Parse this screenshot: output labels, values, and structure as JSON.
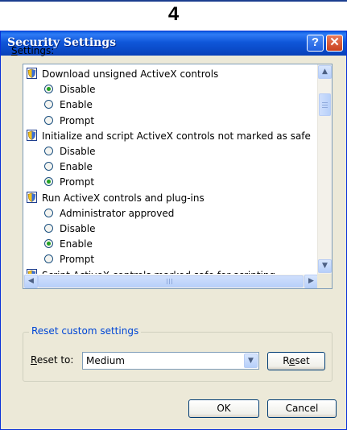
{
  "step": {
    "number": "4"
  },
  "dialog": {
    "title": "Security Settings",
    "help_glyph": "?",
    "close_glyph": "✕",
    "settings_label_first": "S",
    "settings_label_rest": "ettings:",
    "groups": [
      {
        "label": "Download unsigned ActiveX controls",
        "options": [
          {
            "label": "Disable",
            "selected": true
          },
          {
            "label": "Enable",
            "selected": false
          },
          {
            "label": "Prompt",
            "selected": false
          }
        ]
      },
      {
        "label": "Initialize and script ActiveX controls not marked as safe",
        "options": [
          {
            "label": "Disable",
            "selected": false
          },
          {
            "label": "Enable",
            "selected": false
          },
          {
            "label": "Prompt",
            "selected": true
          }
        ]
      },
      {
        "label": "Run ActiveX controls and plug-ins",
        "options": [
          {
            "label": "Administrator approved",
            "selected": false
          },
          {
            "label": "Disable",
            "selected": false
          },
          {
            "label": "Enable",
            "selected": true
          },
          {
            "label": "Prompt",
            "selected": false
          }
        ]
      },
      {
        "label": "Script ActiveX controls marked safe for scripting",
        "options": []
      }
    ],
    "reset_group_label": "Reset custom settings",
    "reset_to_label_first": "R",
    "reset_to_label_rest": "eset to:",
    "reset_to_value": "Medium",
    "reset_button_first": "R",
    "reset_button_underlined": "e",
    "reset_button_rest": "set",
    "ok_label": "OK",
    "cancel_label": "Cancel"
  },
  "colors": {
    "titlebar": "#0a49c5",
    "border": "#0831d9",
    "dialog_bg": "#ece9d8",
    "selected_radio": "#21a121",
    "group_label": "#0046d5"
  },
  "icons": {
    "setting_group": "shield-icon",
    "help": "help-icon",
    "close": "close-icon"
  }
}
